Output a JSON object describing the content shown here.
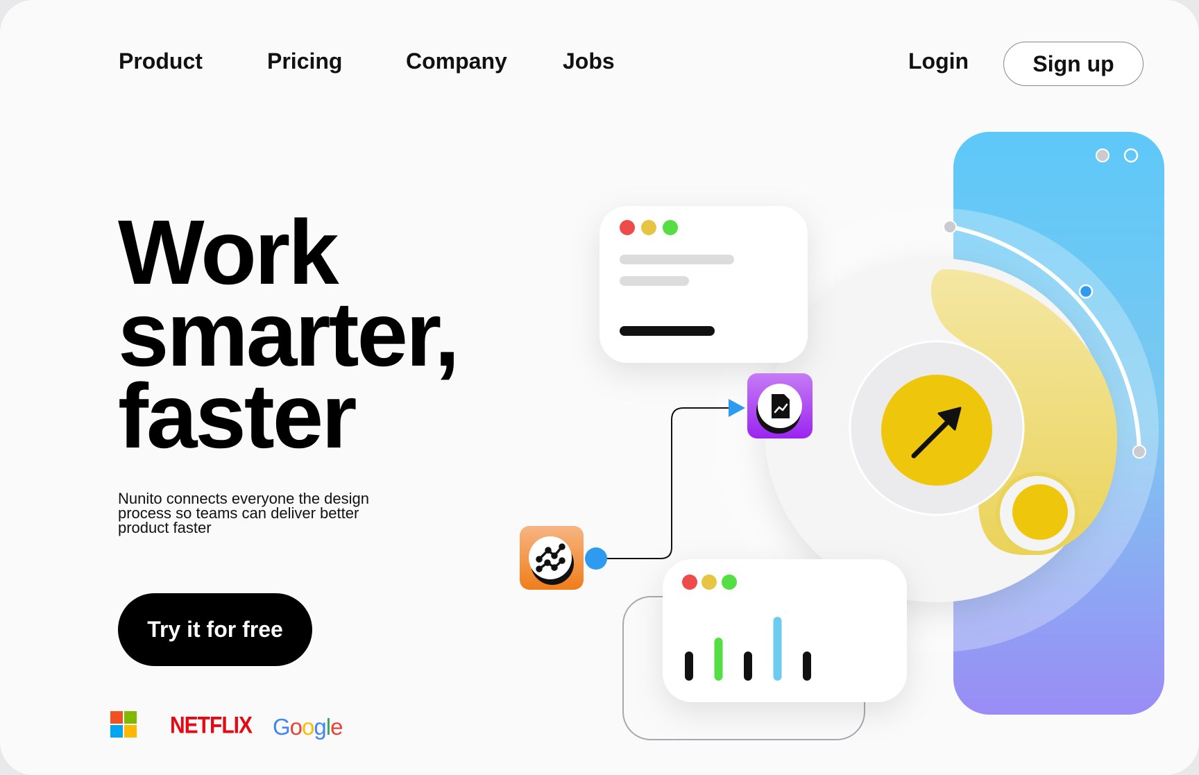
{
  "nav": {
    "items": [
      "Product",
      "Pricing",
      "Company",
      "Jobs"
    ],
    "login": "Login",
    "signup": "Sign up"
  },
  "hero": {
    "title_lines": [
      "Work",
      "smarter,",
      "faster"
    ],
    "subtitle": "Nunito connects everyone the design process so teams can deliver better product faster",
    "cta": "Try it for free"
  },
  "logos": {
    "netflix": "NETFLIX",
    "google": "Google"
  },
  "colors": {
    "yellow": "#eec70c",
    "blue_top": "#5ec8f8",
    "purple_bottom": "#9a8cf5",
    "traffic_red": "#ee4b4b",
    "traffic_yellow": "#e7c443",
    "traffic_green": "#55dd44",
    "connector_blue": "#2f9bf0",
    "icon_orange": "#f07d1a",
    "icon_purple": "#9b25f0"
  },
  "icons": {
    "left_app": "trend-graph-icon",
    "right_app": "document-chart-icon",
    "center": "arrow-up-right-icon"
  },
  "mini_chart_bars": [
    {
      "value": 0.42,
      "color": "#111111"
    },
    {
      "value": 0.62,
      "color": "#55dd44"
    },
    {
      "value": 0.42,
      "color": "#111111"
    },
    {
      "value": 0.92,
      "color": "#6dcbef"
    },
    {
      "value": 0.42,
      "color": "#111111"
    }
  ]
}
